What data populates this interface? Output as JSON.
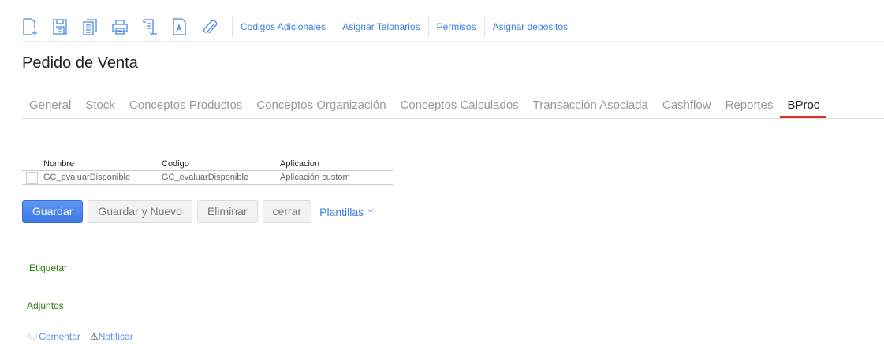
{
  "toolbar": {
    "icons": [
      "new-document-icon",
      "save-icon",
      "copy-icon",
      "print-icon",
      "scroll-icon",
      "pdf-icon",
      "attach-icon"
    ],
    "links": [
      "Codigos Adicionales",
      "Asignar Talonarios",
      "Permisos",
      "Asignar depositos"
    ]
  },
  "page_title": "Pedido de Venta",
  "tabs": [
    "General",
    "Stock",
    "Conceptos Productos",
    "Conceptos Organización",
    "Conceptos Calculados",
    "Transacción Asociada",
    "Cashflow",
    "Reportes",
    "BProc"
  ],
  "active_tab": "BProc",
  "table": {
    "headers": [
      "Nombre",
      "Codigo",
      "Aplicacion"
    ],
    "rows": [
      [
        "GC_evaluarDisponible",
        "GC_evaluarDisponible",
        "Aplicación custom"
      ]
    ]
  },
  "buttons": {
    "save": "Guardar",
    "save_new": "Guardar y Nuevo",
    "delete": "Eliminar",
    "close": "cerrar",
    "templates": "Plantillas"
  },
  "tags_label": "Etiquetar",
  "attachments_label": "Adjuntos",
  "footer": {
    "comment": "Comentar",
    "notify": "Notificar"
  }
}
